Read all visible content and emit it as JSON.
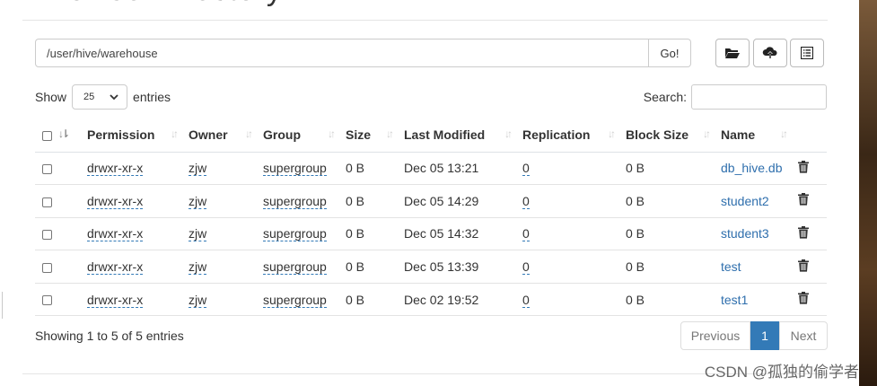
{
  "page": {
    "title": "Browse Directory"
  },
  "path_bar": {
    "value": "/user/hive/warehouse",
    "go_label": "Go!"
  },
  "toolbar": {
    "icons": [
      "folder-open-icon",
      "cloud-upload-icon",
      "list-alt-icon"
    ]
  },
  "entries": {
    "show_label": "Show",
    "page_size": "25",
    "entries_label": "entries"
  },
  "search": {
    "label": "Search:",
    "value": ""
  },
  "table": {
    "columns": [
      "Permission",
      "Owner",
      "Group",
      "Size",
      "Last Modified",
      "Replication",
      "Block Size",
      "Name"
    ],
    "rows": [
      {
        "permission": "drwxr-xr-x",
        "owner": "zjw",
        "group": "supergroup",
        "size": "0 B",
        "modified": "Dec 05 13:21",
        "replication": "0",
        "block_size": "0 B",
        "name": "db_hive.db"
      },
      {
        "permission": "drwxr-xr-x",
        "owner": "zjw",
        "group": "supergroup",
        "size": "0 B",
        "modified": "Dec 05 14:29",
        "replication": "0",
        "block_size": "0 B",
        "name": "student2"
      },
      {
        "permission": "drwxr-xr-x",
        "owner": "zjw",
        "group": "supergroup",
        "size": "0 B",
        "modified": "Dec 05 14:32",
        "replication": "0",
        "block_size": "0 B",
        "name": "student3"
      },
      {
        "permission": "drwxr-xr-x",
        "owner": "zjw",
        "group": "supergroup",
        "size": "0 B",
        "modified": "Dec 05 13:39",
        "replication": "0",
        "block_size": "0 B",
        "name": "test"
      },
      {
        "permission": "drwxr-xr-x",
        "owner": "zjw",
        "group": "supergroup",
        "size": "0 B",
        "modified": "Dec 02 19:52",
        "replication": "0",
        "block_size": "0 B",
        "name": "test1"
      }
    ]
  },
  "footer": {
    "info": "Showing 1 to 5 of 5 entries",
    "prev_label": "Previous",
    "current_page": "1",
    "next_label": "Next"
  },
  "watermark": "CSDN @孤独的偷学者",
  "colors": {
    "link": "#2f6fad",
    "primary": "#337ab7"
  }
}
